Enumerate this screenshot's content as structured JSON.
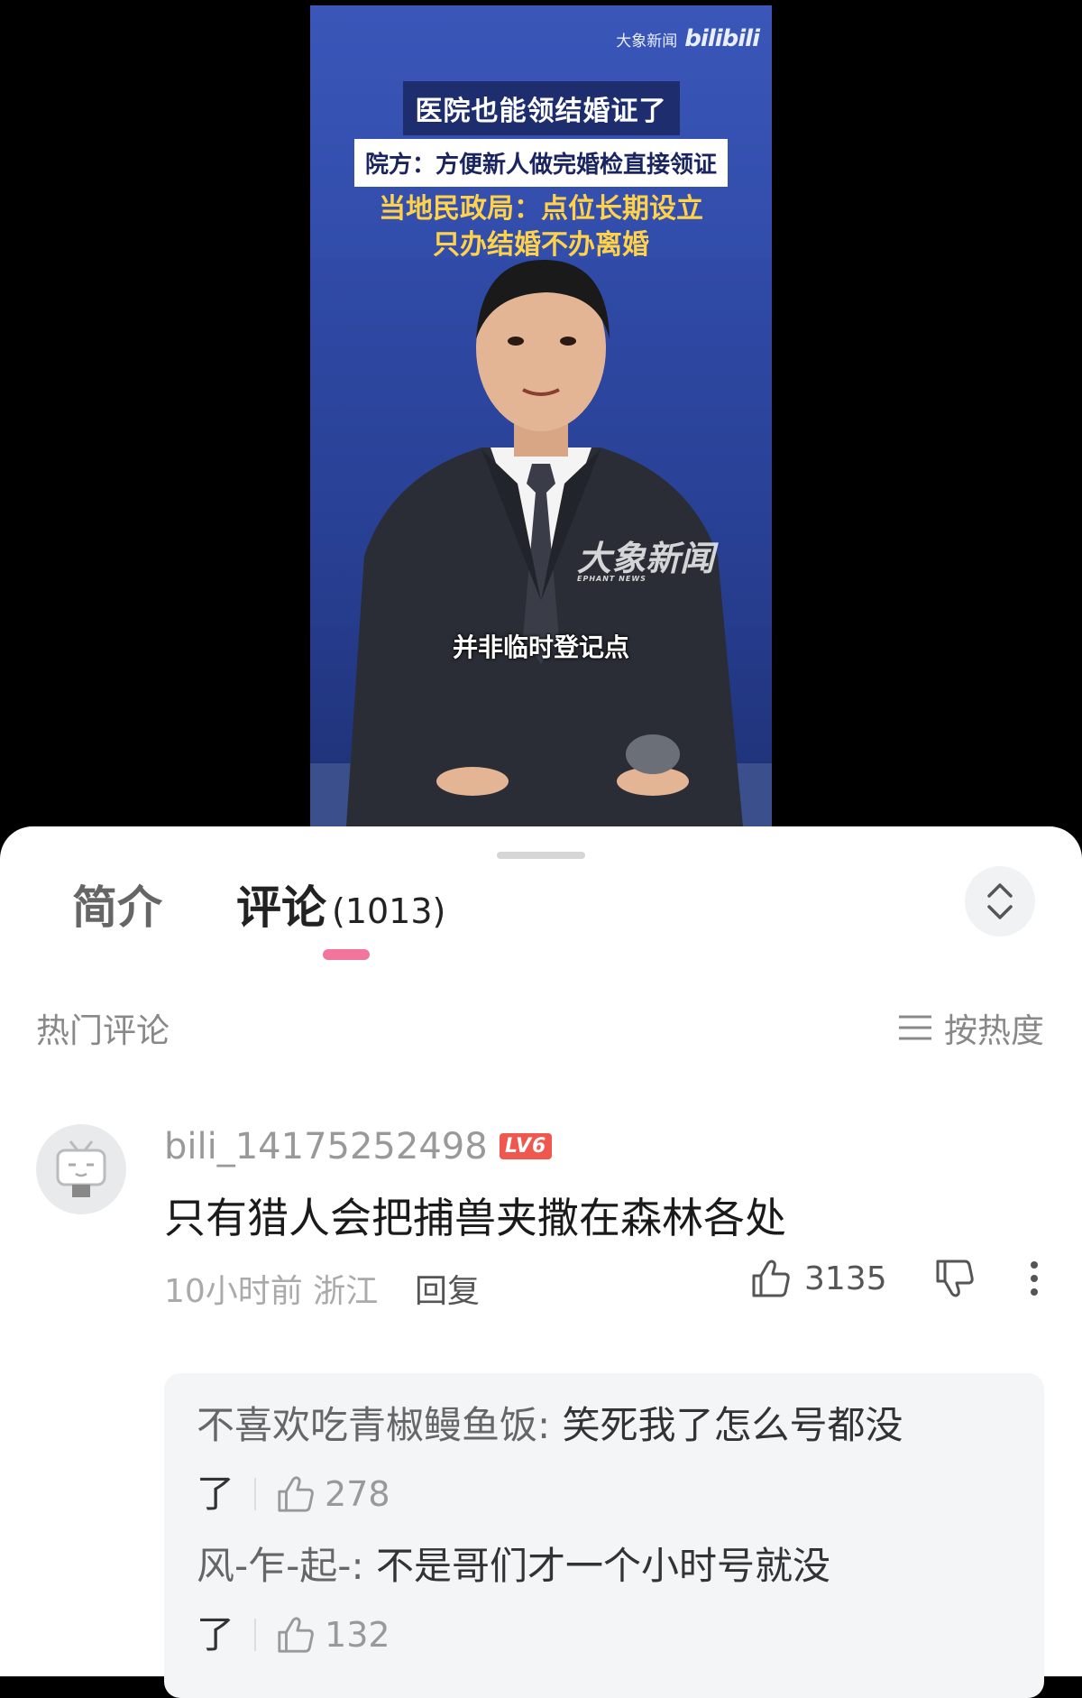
{
  "video": {
    "brand_text": "大象新闻",
    "brand_logo": "bilibili",
    "headline1": "医院也能领结婚证了",
    "headline2": "院方：方便新人做完婚检直接领证",
    "headline3_line1": "当地民政局：点位长期设立",
    "headline3_line2": "只办结婚不办离婚",
    "watermark": "大象新闻",
    "watermark_sub": "EPHANT NEWS",
    "caption": "并非临时登记点"
  },
  "tabs": {
    "intro": "简介",
    "comments": "评论",
    "comments_count": "(1013)"
  },
  "section": {
    "label": "热门评论",
    "sort_label": "按热度"
  },
  "comment": {
    "username": "bili_14175252498",
    "level": "LV6",
    "text": "只有猎人会把捕兽夹撒在森林各处",
    "time_location": "10小时前  浙江",
    "reply_label": "回复",
    "likes": "3135"
  },
  "replies": [
    {
      "name": "不喜欢吃青椒鳗鱼饭:",
      "text": " 笑死我了怎么号都没",
      "tail": "了",
      "likes": "278"
    },
    {
      "name": "风-乍-起-:",
      "text": " 不是哥们才一个小时号就没",
      "tail": "了",
      "likes": "132"
    }
  ],
  "colors": {
    "accent": "#f2769b",
    "level_badge": "#f0574e",
    "video_bg": "#2f4aa6",
    "headline_yellow": "#ffd24a"
  }
}
